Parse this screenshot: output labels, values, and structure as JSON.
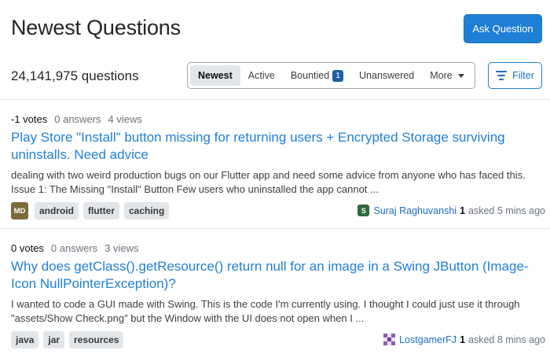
{
  "header": {
    "title": "Newest Questions",
    "ask_button": "Ask Question",
    "question_count": "24,141,975 questions"
  },
  "tabs": {
    "newest": "Newest",
    "active": "Active",
    "bountied": "Bountied",
    "bountied_count": "1",
    "unanswered": "Unanswered",
    "more": "More"
  },
  "filter_button": "Filter",
  "questions": [
    {
      "votes": "-1 votes",
      "answers": "0 answers",
      "views": "4 views",
      "title": "Play Store \"Install\" button missing for returning users + Encrypted Storage surviving uninstalls. Need advice",
      "excerpt": "dealing with two weird production bugs on our Flutter app and need some advice from anyone who has faced this. Issue 1: The Missing \"Install\" Button Few users who uninstalled the app cannot ...",
      "badge": "MD",
      "tags": [
        "android",
        "flutter",
        "caching"
      ],
      "user": "Suraj Raghuvanshi",
      "avatar_letter": "S",
      "rep": "1",
      "asked": "asked 5 mins ago"
    },
    {
      "votes": "0 votes",
      "answers": "0 answers",
      "views": "3 views",
      "title": "Why does getClass().getResource() return null for an image in a Swing JButton (Image-Icon NullPointerException)?",
      "excerpt": "I wanted to code a GUI made with Swing. This is the code I'm currently using. I thought I could just use it through \"assets/Show Check.png\" but the Window with the UI does not open when I ...",
      "tags": [
        "java",
        "jar",
        "resources"
      ],
      "user": "LostgamerFJ",
      "rep": "1",
      "asked": "asked 8 mins ago"
    }
  ],
  "colors": {
    "accent": "#1f7fd6",
    "link": "#1f6fbf",
    "tag_bg": "#e3e6e8",
    "badge": "#1f5ea8"
  }
}
